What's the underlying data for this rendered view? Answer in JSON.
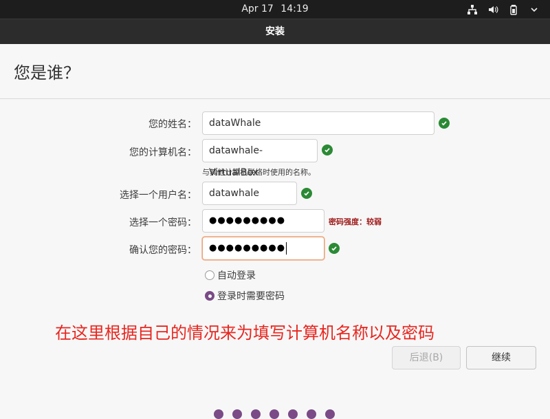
{
  "topbar": {
    "date": "Apr 17",
    "time": "14:19",
    "icons": [
      "network-icon",
      "volume-icon",
      "battery-icon",
      "system-menu-icon"
    ]
  },
  "window": {
    "title": "安装"
  },
  "page": {
    "heading": "您是谁？"
  },
  "form": {
    "name": {
      "label": "您的姓名：",
      "value": "dataWhale",
      "valid": true
    },
    "computer_name": {
      "label": "您的计算机名：",
      "value": "datawhale-VirtualBox",
      "valid": true,
      "hint": "与其他计算机联络时使用的名称。"
    },
    "username": {
      "label": "选择一个用户名：",
      "value": "datawhale",
      "valid": true
    },
    "password": {
      "label": "选择一个密码：",
      "masked": "●●●●●●●●●",
      "strength": "密码强度：较弱"
    },
    "confirm_password": {
      "label": "确认您的密码：",
      "masked": "●●●●●●●●●",
      "valid": true
    },
    "login_options": [
      {
        "label": "自动登录",
        "selected": false
      },
      {
        "label": "登录时需要密码",
        "selected": true
      }
    ]
  },
  "annotation": "在这里根据自己的情况来为填写计算机名称以及密码",
  "buttons": {
    "back": "后退(B)",
    "continue": "继续"
  },
  "progress": {
    "steps": 7
  },
  "colors": {
    "accent": "#7a4b86",
    "valid": "#2b8a35",
    "weak": "#a01c1c",
    "annotation": "#e8261f"
  }
}
